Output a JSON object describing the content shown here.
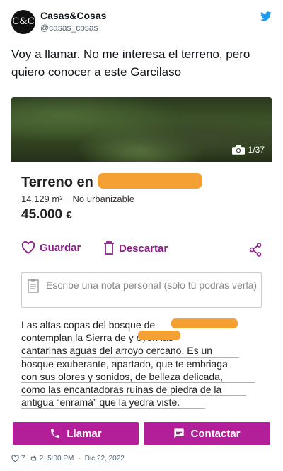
{
  "author": {
    "avatar_text": "C&C",
    "name": "Casas&Cosas",
    "handle": "@casas_cosas",
    "platform_icon": "twitter-bird-icon"
  },
  "tweet": {
    "text": "Voy a llamar. No me interesa el terreno, pero quiero conocer a este Garcilaso"
  },
  "listing": {
    "photo_counter": "1/37",
    "title": "Terreno en",
    "area": "14.129 m²",
    "status": "No urbanizable",
    "price": "45.000",
    "currency": "€",
    "save_label": "Guardar",
    "discard_label": "Descartar",
    "note_placeholder": "Escribe una nota personal (sólo tú podrás verla)",
    "description_lines": [
      "Las altas copas del bosque de",
      "contemplan la Sierra de                y oyen las",
      "cantarinas aguas del arroyo cercano, Es un",
      "bosque exuberante, apartado, que te embriaga",
      "con sus olores y sonidos, de belleza delicada,",
      "como las encantadoras ruinas de piedra de la",
      "antigua “enramá” que la yedra viste."
    ],
    "call_label": "Llamar",
    "contact_label": "Contactar"
  },
  "colors": {
    "accent": "#8a1f8a",
    "cta": "#b21f98",
    "redaction": "#f5a032",
    "twitter_blue": "#1d9bf0"
  },
  "footer": {
    "likes": "7",
    "retweets": "2",
    "time": "5:00 PM",
    "separator": "·",
    "date": "Dic 22, 2022"
  }
}
